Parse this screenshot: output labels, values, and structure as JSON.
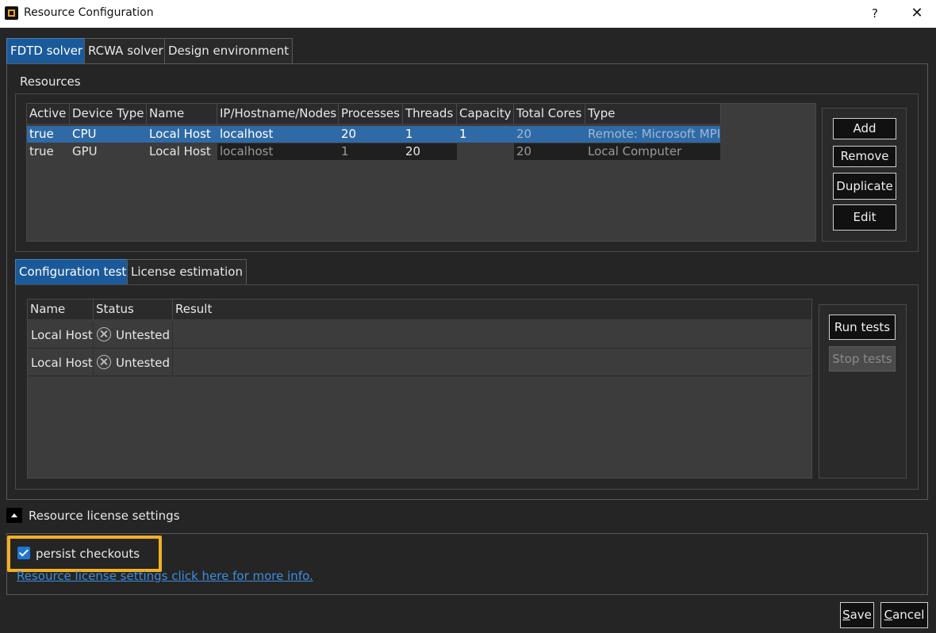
{
  "window": {
    "title": "Resource Configuration",
    "help": "?",
    "close": "✕"
  },
  "tabs": [
    "FDTD solver",
    "RCWA solver",
    "Design environment"
  ],
  "resources": {
    "label": "Resources",
    "columns": [
      "Active",
      "Device Type",
      "Name",
      "IP/Hostname/Nodes",
      "Processes",
      "Threads",
      "Capacity",
      "Total Cores",
      "Type"
    ],
    "rows": [
      {
        "active": "true",
        "device_type": "CPU",
        "name": "Local Host",
        "host": "localhost",
        "processes": "20",
        "threads": "1",
        "capacity": "1",
        "total_cores": "20",
        "type": "Remote: Microsoft MPI"
      },
      {
        "active": "true",
        "device_type": "GPU",
        "name": "Local Host",
        "host": "localhost",
        "processes": "1",
        "threads": "20",
        "capacity": "",
        "total_cores": "20",
        "type": "Local Computer"
      }
    ],
    "buttons": {
      "add": "Add",
      "remove": "Remove",
      "duplicate": "Duplicate",
      "edit": "Edit"
    }
  },
  "subtabs": [
    "Configuration test",
    "License estimation"
  ],
  "config_test": {
    "columns": [
      "Name",
      "Status",
      "Result"
    ],
    "rows": [
      {
        "name": "Local Host",
        "status": "Untested",
        "result": ""
      },
      {
        "name": "Local Host",
        "status": "Untested",
        "result": ""
      }
    ],
    "buttons": {
      "run": "Run tests",
      "stop": "Stop tests"
    }
  },
  "license_settings": {
    "label": "Resource license settings",
    "persist_label": "persist checkouts",
    "persist_checked": true,
    "link": "Resource license settings click here for more info."
  },
  "footer": {
    "save_first": "S",
    "save_rest": "ave",
    "cancel_first": "C",
    "cancel_rest": "ancel"
  },
  "colors": {
    "accent": "#1b5a9a",
    "selection": "#2f6aa6",
    "highlight": "#f3b022",
    "link": "#3b8fe0"
  }
}
